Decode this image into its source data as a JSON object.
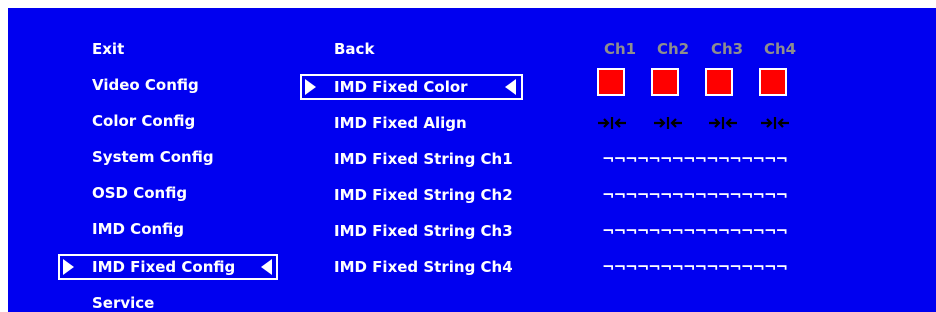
{
  "menu": {
    "left": [
      "Exit",
      "Video Config",
      "Color Config",
      "System Config",
      "OSD Config",
      "IMD Config",
      "IMD Fixed Config",
      "Service"
    ],
    "left_selected_index": 6,
    "right": [
      "Back",
      "IMD Fixed Color",
      "IMD Fixed Align",
      "IMD Fixed String Ch1",
      "IMD Fixed String Ch2",
      "IMD Fixed String Ch3",
      "IMD Fixed String Ch4"
    ],
    "right_selected_index": 1
  },
  "channels": {
    "headers": [
      "Ch1",
      "Ch2",
      "Ch3",
      "Ch4"
    ],
    "colors": [
      "#ff0000",
      "#ff0000",
      "#ff0000",
      "#ff0000"
    ],
    "align_icon": "center-align-arrows-icon",
    "strings": [
      "¬¬¬¬¬¬¬¬¬¬¬¬¬¬¬¬",
      "¬¬¬¬¬¬¬¬¬¬¬¬¬¬¬¬",
      "¬¬¬¬¬¬¬¬¬¬¬¬¬¬¬¬",
      "¬¬¬¬¬¬¬¬¬¬¬¬¬¬¬¬"
    ]
  },
  "colors": {
    "background": "#0000f0",
    "text": "#ffffff",
    "header_text": "#8e8e8e"
  }
}
